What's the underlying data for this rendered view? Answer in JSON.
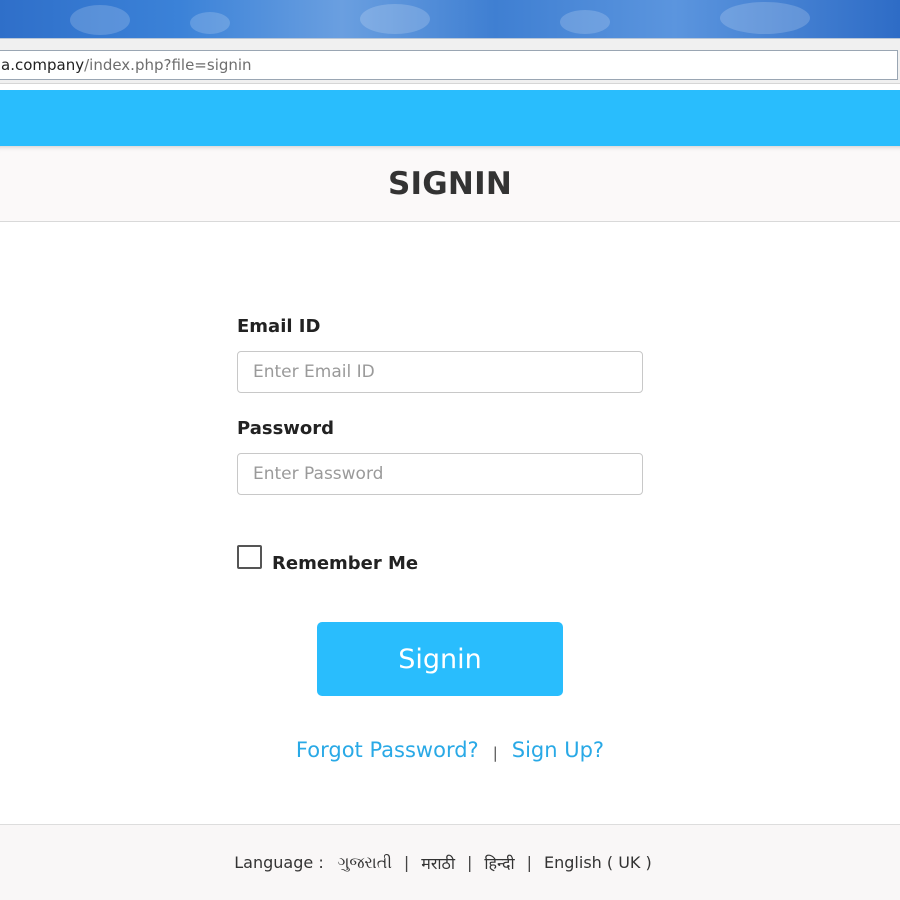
{
  "browser": {
    "url_host": "a.company",
    "url_path": "/index.php?file=signin"
  },
  "page": {
    "title": "SIGNIN"
  },
  "form": {
    "email_label": "Email ID",
    "email_placeholder": "Enter Email ID",
    "email_value": "",
    "password_label": "Password",
    "password_placeholder": "Enter Password",
    "password_value": "",
    "remember_label": "Remember Me",
    "remember_checked": false,
    "submit_label": "Signin"
  },
  "links": {
    "forgot": "Forgot Password?",
    "separator": "|",
    "signup": "Sign Up?"
  },
  "footer": {
    "language_label": "Language :",
    "languages": [
      "ગુજરાતી",
      "मराठी",
      "हिन्दी",
      "English ( UK )"
    ],
    "separator": "|"
  },
  "colors": {
    "accent": "#29bdfd",
    "link": "#29a9e6"
  }
}
